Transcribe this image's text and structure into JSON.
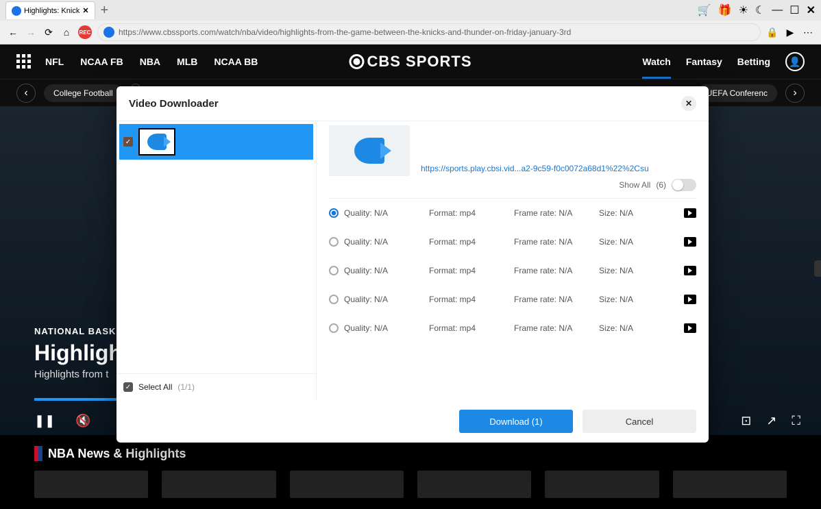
{
  "browser": {
    "tab_title": "Highlights: Knick",
    "url": "https://www.cbssports.com/watch/nba/video/highlights-from-the-game-between-the-knicks-and-thunder-on-friday-january-3rd"
  },
  "site": {
    "logo": "CBS SPORTS",
    "nav": [
      "NFL",
      "NCAA FB",
      "NBA",
      "MLB",
      "NCAA BB"
    ],
    "rightnav": {
      "watch": "Watch",
      "fantasy": "Fantasy",
      "betting": "Betting"
    },
    "subbar": {
      "left_chip": "College Football",
      "right_chip": "UEFA Conferenc"
    }
  },
  "video": {
    "eyebrow": "NATIONAL BASKET",
    "title": "Highlights:",
    "desc": "Highlights from t",
    "below_heading": "NBA News & Highlights"
  },
  "modal": {
    "title": "Video Downloader",
    "source_url": "https://sports.play.cbsi.vid...a2-9c59-f0c0072a68d1%22%2Csu",
    "show_all_label": "Show All",
    "show_all_count": "(6)",
    "rows": [
      {
        "quality": "Quality: N/A",
        "format": "Format: mp4",
        "framerate": "Frame rate: N/A",
        "size": "Size: N/A",
        "selected": true
      },
      {
        "quality": "Quality: N/A",
        "format": "Format: mp4",
        "framerate": "Frame rate: N/A",
        "size": "Size: N/A",
        "selected": false
      },
      {
        "quality": "Quality: N/A",
        "format": "Format: mp4",
        "framerate": "Frame rate: N/A",
        "size": "Size: N/A",
        "selected": false
      },
      {
        "quality": "Quality: N/A",
        "format": "Format: mp4",
        "framerate": "Frame rate: N/A",
        "size": "Size: N/A",
        "selected": false
      },
      {
        "quality": "Quality: N/A",
        "format": "Format: mp4",
        "framerate": "Frame rate: N/A",
        "size": "Size: N/A",
        "selected": false
      }
    ],
    "select_all_label": "Select All",
    "select_all_count": "(1/1)",
    "download_label": "Download (1)",
    "cancel_label": "Cancel"
  }
}
